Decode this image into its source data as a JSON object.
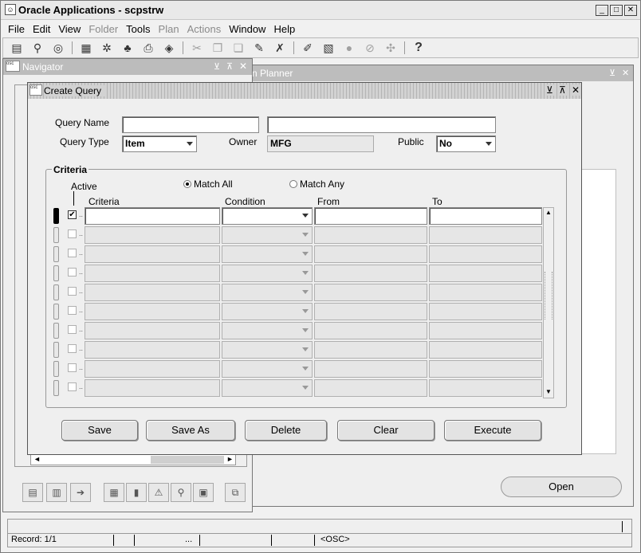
{
  "window": {
    "title": "Oracle Applications - scpstrw"
  },
  "menubar": {
    "items": [
      {
        "label": "File",
        "enabled": true
      },
      {
        "label": "Edit",
        "enabled": true
      },
      {
        "label": "View",
        "enabled": true
      },
      {
        "label": "Folder",
        "enabled": false
      },
      {
        "label": "Tools",
        "enabled": true
      },
      {
        "label": "Plan",
        "enabled": false
      },
      {
        "label": "Actions",
        "enabled": false
      },
      {
        "label": "Window",
        "enabled": true
      },
      {
        "label": "Help",
        "enabled": true
      }
    ]
  },
  "toolbar": {
    "help_label": "?"
  },
  "navigator": {
    "title": "Navigator"
  },
  "planner": {
    "title_fragment": "hain Planner",
    "open_label": "Open"
  },
  "create_query": {
    "title": "Create Query",
    "labels": {
      "query_name": "Query Name",
      "query_type": "Query Type",
      "owner": "Owner",
      "public": "Public"
    },
    "values": {
      "query_name": "",
      "description": "",
      "query_type": "Item",
      "owner": "MFG",
      "public": "No"
    },
    "criteria": {
      "legend": "Criteria",
      "match_all": "Match All",
      "match_any": "Match Any",
      "match_mode": "all",
      "columns": {
        "active": "Active",
        "criteria": "Criteria",
        "condition": "Condition",
        "from": "From",
        "to": "To"
      },
      "rows": [
        {
          "active": true,
          "criteria": "",
          "condition": "",
          "from": "",
          "to": "",
          "current": true
        },
        {
          "active": false,
          "criteria": "",
          "condition": "",
          "from": "",
          "to": "",
          "current": false
        },
        {
          "active": false,
          "criteria": "",
          "condition": "",
          "from": "",
          "to": "",
          "current": false
        },
        {
          "active": false,
          "criteria": "",
          "condition": "",
          "from": "",
          "to": "",
          "current": false
        },
        {
          "active": false,
          "criteria": "",
          "condition": "",
          "from": "",
          "to": "",
          "current": false
        },
        {
          "active": false,
          "criteria": "",
          "condition": "",
          "from": "",
          "to": "",
          "current": false
        },
        {
          "active": false,
          "criteria": "",
          "condition": "",
          "from": "",
          "to": "",
          "current": false
        },
        {
          "active": false,
          "criteria": "",
          "condition": "",
          "from": "",
          "to": "",
          "current": false
        },
        {
          "active": false,
          "criteria": "",
          "condition": "",
          "from": "",
          "to": "",
          "current": false
        },
        {
          "active": false,
          "criteria": "",
          "condition": "",
          "from": "",
          "to": "",
          "current": false
        }
      ]
    },
    "buttons": {
      "save": "Save",
      "save_as": "Save As",
      "delete": "Delete",
      "clear": "Clear",
      "execute": "Execute"
    }
  },
  "statusbar": {
    "record": "Record: 1/1",
    "ellipsis": "...",
    "mode": "<OSC>"
  }
}
